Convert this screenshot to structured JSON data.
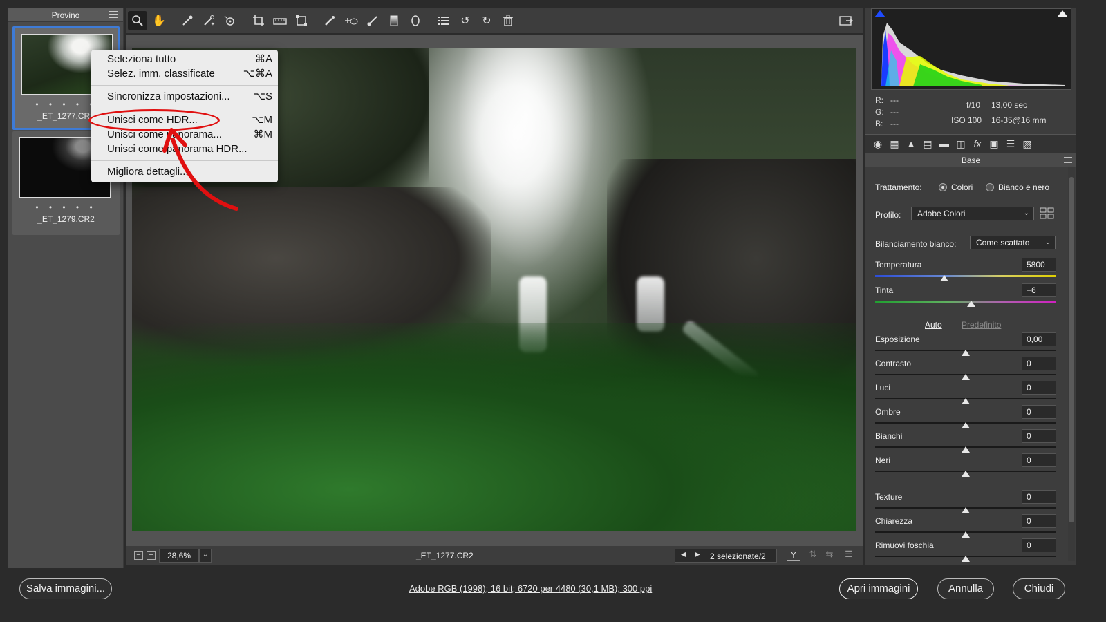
{
  "filmstrip": {
    "title": "Provino",
    "items": [
      {
        "name": "_ET_1277.CR2",
        "dots": "• • • • •",
        "selected": true
      },
      {
        "name": "_ET_1279.CR2",
        "dots": "• • • • •",
        "selected": false
      }
    ]
  },
  "toolbar": {
    "tools": [
      "zoom-icon",
      "hand-icon",
      "white-balance-icon",
      "color-sampler-icon",
      "targeted-adjustment-icon",
      "crop-icon",
      "straighten-icon",
      "transform-icon",
      "spot-removal-icon",
      "red-eye-icon",
      "adjustment-brush-icon",
      "graduated-filter-icon",
      "radial-filter-icon",
      "preferences-icon",
      "rotate-left-icon",
      "rotate-right-icon",
      "trash-icon"
    ],
    "right_icon": "fullscreen-icon"
  },
  "context_menu": {
    "items": [
      {
        "label": "Seleziona tutto",
        "shortcut": "⌘A"
      },
      {
        "label": "Selez. imm. classificate",
        "shortcut": "⌥⌘A"
      },
      {
        "label": "Sincronizza impostazioni...",
        "shortcut": "⌥S"
      },
      {
        "label": "Unisci come HDR...",
        "shortcut": "⌥M"
      },
      {
        "label": "Unisci come panorama...",
        "shortcut": "⌘M"
      },
      {
        "label": "Unisci come panorama HDR...",
        "shortcut": ""
      },
      {
        "label": "Migliora dettagli...",
        "shortcut": ""
      }
    ],
    "highlight_color": "#e01010"
  },
  "canvas_bar": {
    "zoom": "28,6%",
    "filename": "_ET_1277.CR2",
    "selection_count": "2 selezionate/2"
  },
  "histogram": {
    "r_label": "R:",
    "g_label": "G:",
    "b_label": "B:",
    "r_value": "---",
    "g_value": "---",
    "b_value": "---",
    "aperture": "f/10",
    "shutter": "13,00 sec",
    "iso": "ISO 100",
    "lens": "16-35@16 mm"
  },
  "panel": {
    "title": "Base",
    "treatment_label": "Trattamento:",
    "treatment_color": "Colori",
    "treatment_bw": "Bianco e nero",
    "profile_label": "Profilo:",
    "profile_value": "Adobe Colori",
    "wb_label": "Bilanciamento bianco:",
    "wb_value": "Come scattato",
    "temperature": {
      "label": "Temperatura",
      "value": "5800",
      "position": 0.38
    },
    "tint": {
      "label": "Tinta",
      "value": "+6",
      "position": 0.53
    },
    "auto": "Auto",
    "default": "Predefinito",
    "sliders": [
      {
        "label": "Esposizione",
        "value": "0,00",
        "position": 0.5
      },
      {
        "label": "Contrasto",
        "value": "0",
        "position": 0.5
      },
      {
        "label": "Luci",
        "value": "0",
        "position": 0.5
      },
      {
        "label": "Ombre",
        "value": "0",
        "position": 0.5
      },
      {
        "label": "Bianchi",
        "value": "0",
        "position": 0.5
      },
      {
        "label": "Neri",
        "value": "0",
        "position": 0.5
      },
      {
        "label": "Texture",
        "value": "0",
        "position": 0.5
      },
      {
        "label": "Chiarezza",
        "value": "0",
        "position": 0.5
      },
      {
        "label": "Rimuovi foschia",
        "value": "0",
        "position": 0.5
      }
    ]
  },
  "bottom": {
    "save_label": "Salva immagini...",
    "workflow": "Adobe RGB (1998); 16 bit; 6720 per 4480 (30,1 MB); 300 ppi",
    "open_label": "Apri immagini",
    "cancel_label": "Annulla",
    "close_label": "Chiudi"
  }
}
